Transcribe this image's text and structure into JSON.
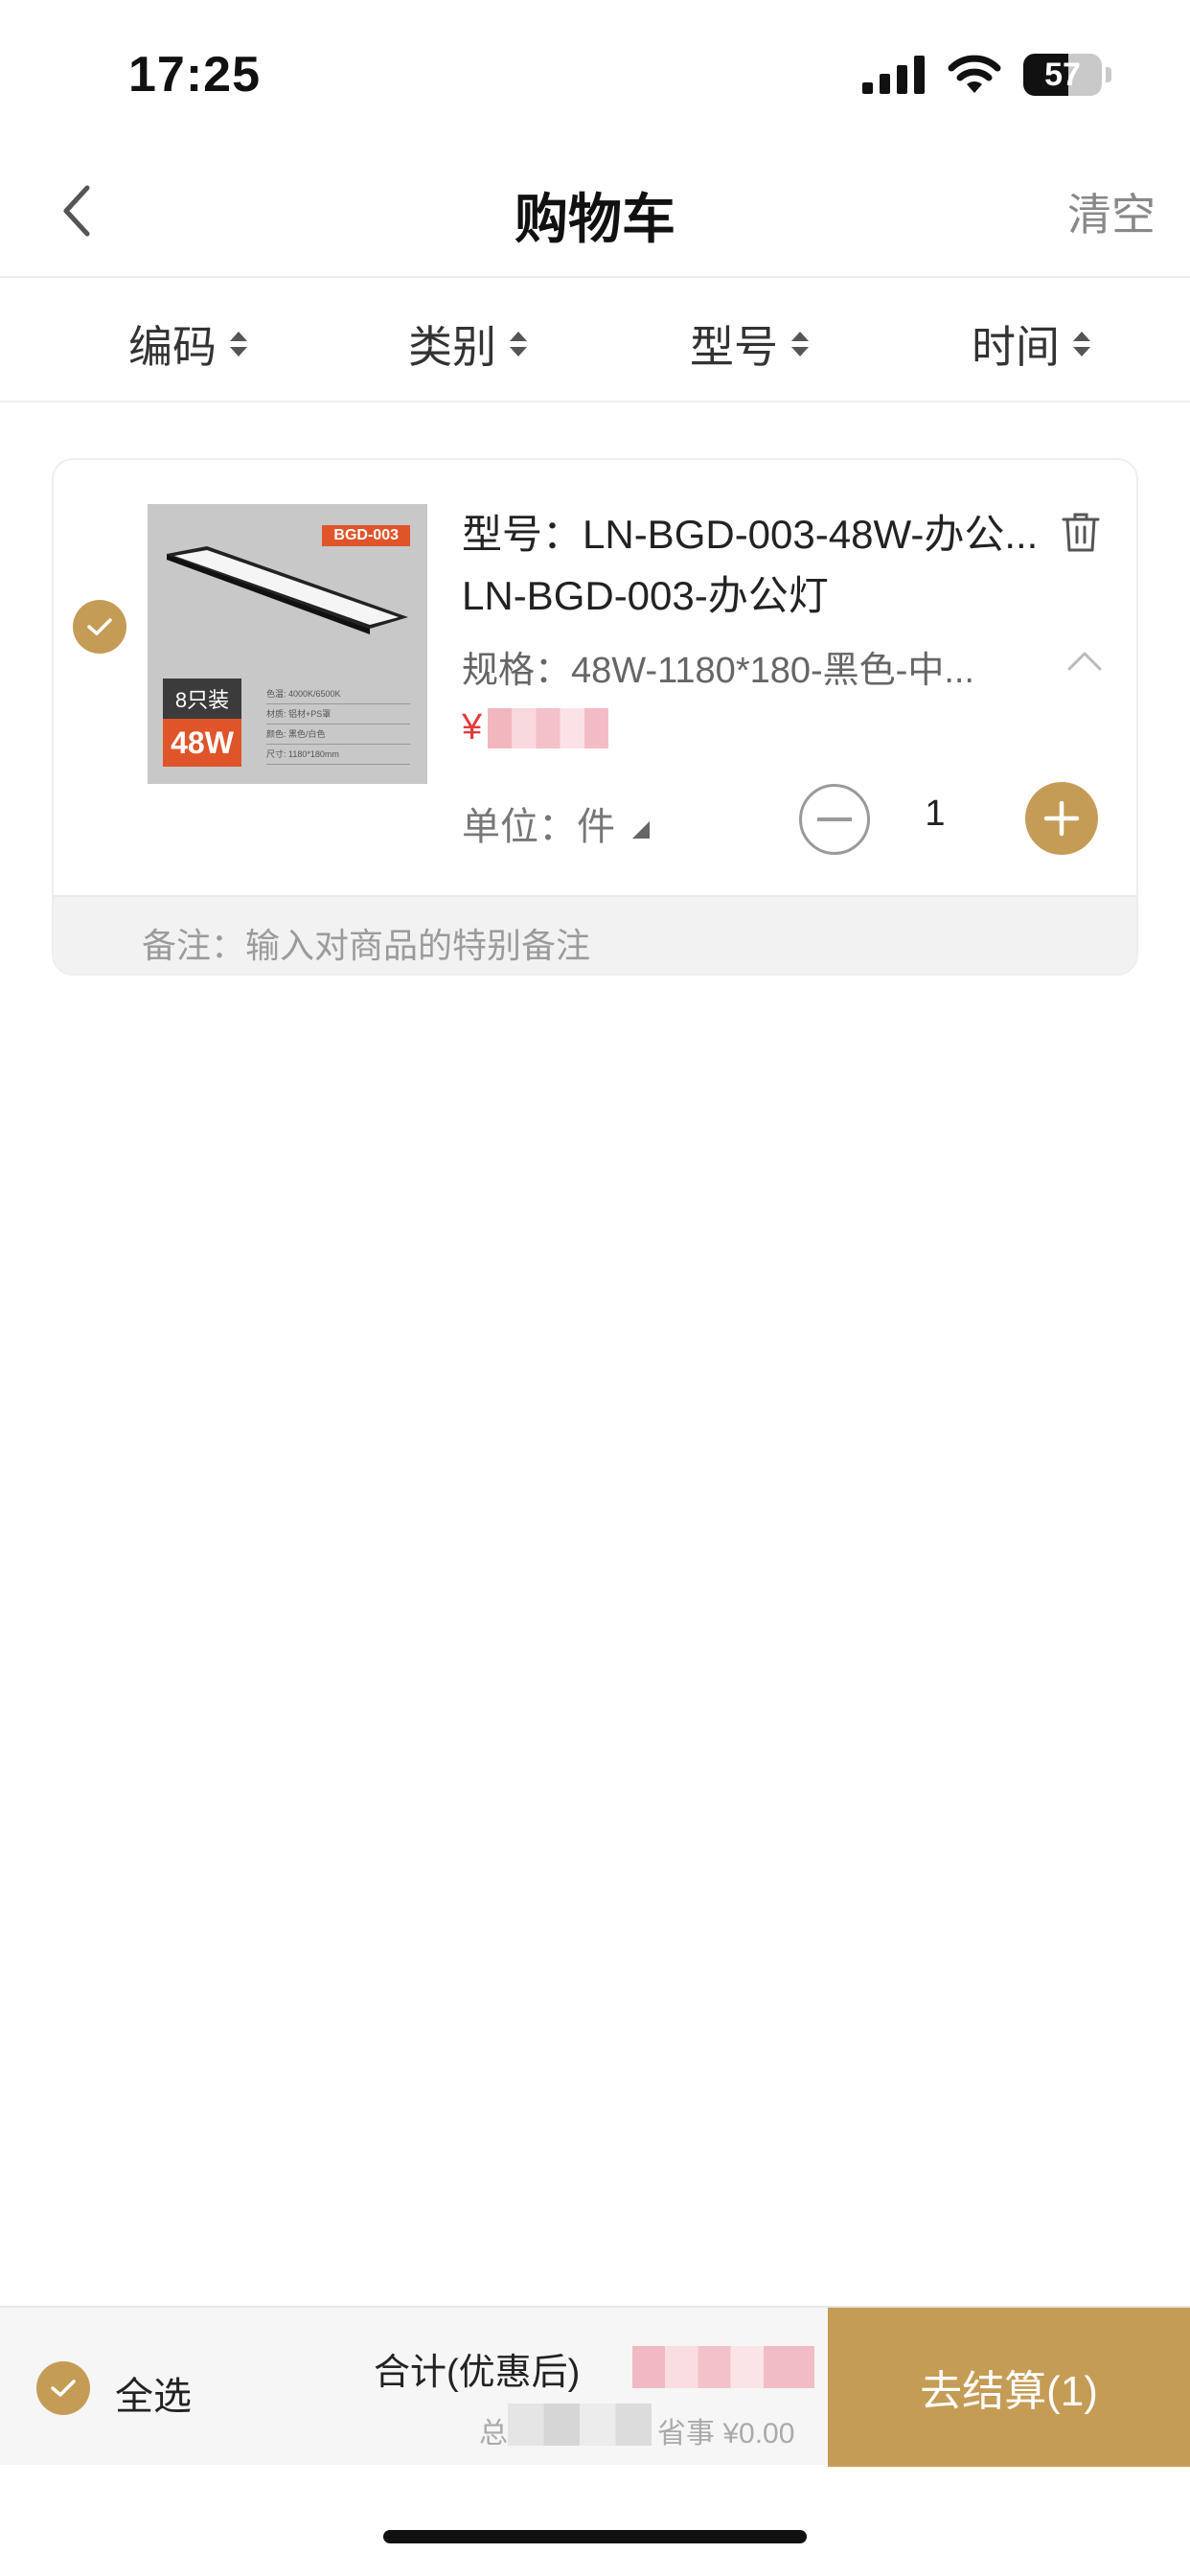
{
  "status_bar": {
    "time": "17:25",
    "battery_level": "57",
    "battery_fraction": 0.57
  },
  "nav": {
    "title": "购物车",
    "clear_label": "清空"
  },
  "sort_bar": {
    "items": [
      "编码",
      "类别",
      "型号",
      "时间"
    ]
  },
  "cart_item": {
    "checked": true,
    "image": {
      "badge": "BGD-003",
      "pack": "8只装",
      "power": "48W",
      "spec_lines": [
        "色温: 4000K/6500K",
        "材质: 铝材+PS罩",
        "颜色: 黑色/白色",
        "尺寸: 1180*180mm"
      ]
    },
    "model_text": "型号：LN-BGD-003-48W-办公...",
    "name": "LN-BGD-003-办公灯",
    "spec_text": "规格：48W-1180*180-黑色-中...",
    "price_symbol": "¥",
    "unit_text": "单位：件",
    "quantity": "1",
    "remark_placeholder": "备注：输入对商品的特别备注"
  },
  "bottom_bar": {
    "select_all_label": "全选",
    "total_label": "合计(优惠后)",
    "saving_prefix": "总",
    "saving_text": "省事 ¥0.00",
    "checkout_label": "去结算(1)"
  },
  "colors": {
    "accent": "#c59c55",
    "price": "#e23b3b"
  }
}
